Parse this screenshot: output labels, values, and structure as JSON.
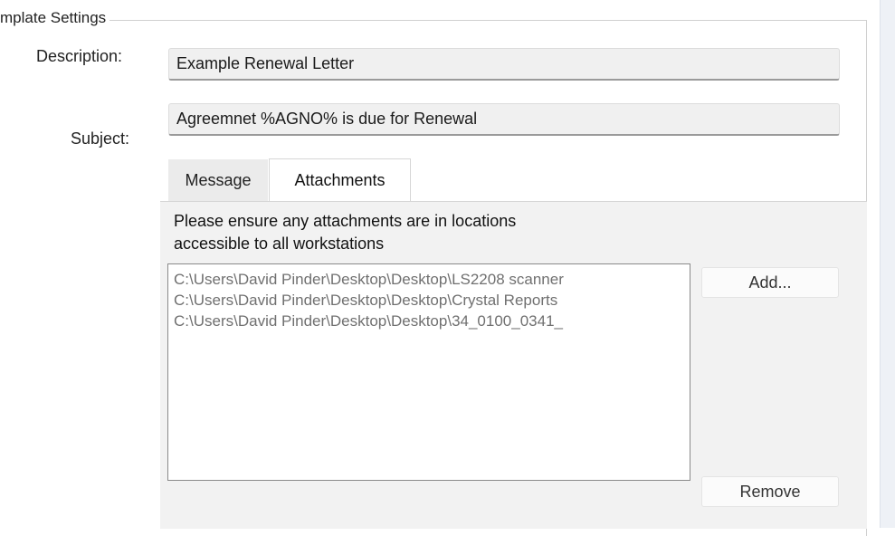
{
  "group": {
    "title": "mplate Settings"
  },
  "description": {
    "label": "Description:",
    "value": "Example Renewal Letter"
  },
  "subject": {
    "label": "Subject:",
    "value": "Agreemnet %AGNO% is due for Renewal"
  },
  "tabs": [
    {
      "label": "Message",
      "selected": false
    },
    {
      "label": "Attachments",
      "selected": true
    }
  ],
  "attachments": {
    "notice_line1": "Please ensure any attachments are in locations",
    "notice_line2": "accessible to all workstations",
    "items": [
      "C:\\Users\\David Pinder\\Desktop\\Desktop\\LS2208 scanner",
      "C:\\Users\\David Pinder\\Desktop\\Desktop\\Crystal Reports",
      "C:\\Users\\David Pinder\\Desktop\\Desktop\\34_0100_0341_"
    ],
    "add_label": "Add...",
    "remove_label": "Remove"
  }
}
